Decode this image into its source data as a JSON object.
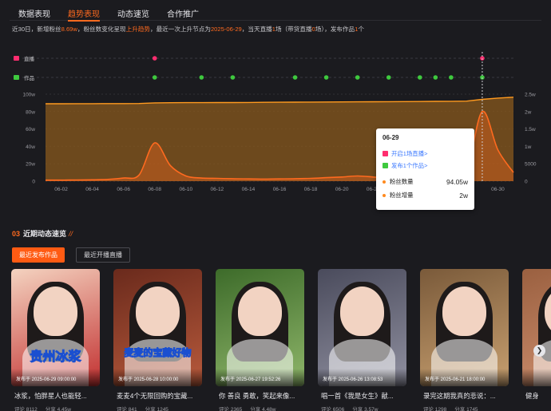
{
  "tabs": [
    {
      "label": "数据表现",
      "active": false
    },
    {
      "label": "趋势表现",
      "active": true
    },
    {
      "label": "动态速览",
      "active": false
    },
    {
      "label": "合作推广",
      "active": false
    }
  ],
  "summary": {
    "p1": "近30日，新增粉丝",
    "fans_added": "8.69w",
    "p2": "，粉丝数变化呈现",
    "trend": "上升趋势",
    "p3": "，最近一次上升节点为",
    "last_date": "2025-06-29",
    "p4": "，当天直播",
    "live_count": "1",
    "p5": "场（带货直播",
    "live_sale": "0",
    "p6": "场），发布作品",
    "works": "1",
    "p7": "个"
  },
  "chart_data": {
    "type": "area",
    "event_rows": [
      {
        "label": "直播",
        "icon": "live-icon",
        "color": "#ff2d6f",
        "days": [
          "06-08",
          "06-29"
        ]
      },
      {
        "label": "作品",
        "icon": "works-icon",
        "color": "#3ec93e",
        "days": [
          "06-08",
          "06-11",
          "06-13",
          "06-17",
          "06-19",
          "06-21",
          "06-23",
          "06-25",
          "06-26",
          "06-27",
          "06-29"
        ]
      }
    ],
    "x_tick_labels": [
      "06-02",
      "06-04",
      "06-06",
      "06-08",
      "06-10",
      "06-12",
      "06-14",
      "06-16",
      "06-18",
      "06-20",
      "06-22",
      "06-24",
      "06-26",
      "06-28",
      "06-30"
    ],
    "x": [
      "06-01",
      "06-02",
      "06-03",
      "06-04",
      "06-05",
      "06-06",
      "06-07",
      "06-08",
      "06-09",
      "06-10",
      "06-11",
      "06-12",
      "06-13",
      "06-14",
      "06-15",
      "06-16",
      "06-17",
      "06-18",
      "06-19",
      "06-20",
      "06-21",
      "06-22",
      "06-23",
      "06-24",
      "06-25",
      "06-26",
      "06-27",
      "06-28",
      "06-29",
      "06-30",
      "07-01"
    ],
    "left_axis_ticks": [
      "100w",
      "80w",
      "60w",
      "40w",
      "20w",
      "0"
    ],
    "right_axis_ticks": [
      "2.5w",
      "2w",
      "1.5w",
      "1w",
      "5000",
      "0"
    ],
    "ylim_left": [
      0,
      1000000
    ],
    "ylim_right": [
      0,
      25000
    ],
    "series": [
      {
        "name": "粉丝数量",
        "axis": "left",
        "color": "#ff9a1f",
        "values": [
          890000,
          890000,
          891000,
          891000,
          892000,
          892000,
          893000,
          900000,
          902000,
          903000,
          903000,
          904000,
          904000,
          905000,
          906000,
          907000,
          908000,
          909000,
          910000,
          911000,
          912000,
          913000,
          914000,
          915000,
          916000,
          917000,
          918000,
          920000,
          940000,
          955000,
          965000
        ]
      },
      {
        "name": "粉丝增量",
        "axis": "right",
        "color": "#ff6a1f",
        "values": [
          300,
          300,
          350,
          400,
          500,
          900,
          1800,
          11000,
          4500,
          1500,
          900,
          800,
          700,
          650,
          600,
          650,
          700,
          800,
          1000,
          1200,
          1500,
          1200,
          900,
          800,
          700,
          800,
          1500,
          3000,
          20000,
          9000,
          2500
        ]
      }
    ],
    "highlight_x": "06-29"
  },
  "tooltip": {
    "date": "06-29",
    "live_link": "开启1场直播>",
    "works_link": "发布1个作品>",
    "fans_label": "粉丝数量",
    "fans_value": "94.05w",
    "increase_label": "粉丝增量",
    "increase_value": "2w"
  },
  "section": {
    "number": "03",
    "title": "近期动态速览",
    "slash": "//"
  },
  "buttons": {
    "recent_works": "最近发布作品",
    "recent_live": "最近开播直播"
  },
  "cards": [
    {
      "overlay_text": "贵州冰浆",
      "published": "发布于 2025-06-29 09:00:00",
      "title": "冰浆，怕胖星人也能轻...",
      "comments": "评论 8112",
      "shares": "分享 4.45w",
      "bg": [
        "#f4d3c0",
        "#c23030"
      ]
    },
    {
      "overlay_text": "麦麦的宝藏好物",
      "published": "发布于 2025-06-28 10:00:00",
      "title": "麦麦4个无限回购的宝藏...",
      "comments": "评论 841",
      "shares": "分享 1245",
      "bg": [
        "#6a2a1c",
        "#b85a3c"
      ]
    },
    {
      "overlay_text": "",
      "published": "发布于 2025-06-27 19:52:26",
      "title": "你 善良 勇敢，笑起来像...",
      "comments": "评论 2365",
      "shares": "分享 4.48w",
      "bg": [
        "#3d6b2a",
        "#8fb66a"
      ]
    },
    {
      "overlay_text": "",
      "published": "发布于 2025-06-26 13:08:53",
      "title": "唱一首《我是女生》献...",
      "comments": "评论 6506",
      "shares": "分享 3.57w",
      "bg": [
        "#4a4b5c",
        "#9090a0"
      ]
    },
    {
      "overlay_text": "",
      "published": "发布于 2025-06-21 18:00:00",
      "title": "录完这期我真的悲说：...",
      "comments": "评论 1298",
      "shares": "分享 1745",
      "bg": [
        "#7a5a3a",
        "#c8a070"
      ]
    },
    {
      "overlay_text": "",
      "published": "",
      "title": "健身",
      "comments": "",
      "shares": "",
      "bg": [
        "#9a6040",
        "#d09070"
      ]
    }
  ]
}
